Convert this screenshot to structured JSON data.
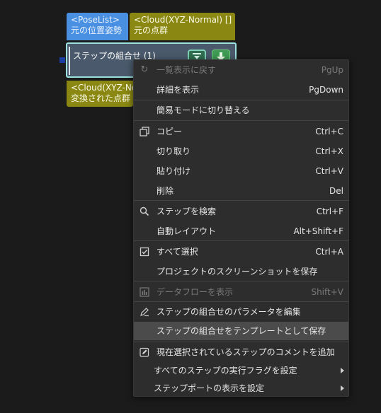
{
  "ports_top": [
    {
      "type": "<PoseList>",
      "label": "元の位置姿勢"
    },
    {
      "type": "<Cloud(XYZ-Normal) [] >",
      "label": "元の点群"
    }
  ],
  "step": {
    "title": "ステップの組合せ (1)"
  },
  "ports_bottom": [
    {
      "type": "<Cloud(XYZ-Normal)",
      "label": "変換された点群"
    }
  ],
  "menu": {
    "items": [
      {
        "icon": "undo-icon",
        "label": "一覧表示に戻す",
        "shortcut": "PgUp",
        "disabled": true
      },
      {
        "label": "詳細を表示",
        "shortcut": "PgDown"
      },
      {
        "label": "簡易モードに切り替える",
        "shortcut": ""
      },
      {
        "icon": "copy-icon",
        "label": "コピー",
        "shortcut": "Ctrl+C"
      },
      {
        "label": "切り取り",
        "shortcut": "Ctrl+X"
      },
      {
        "label": "貼り付け",
        "shortcut": "Ctrl+V"
      },
      {
        "label": "削除",
        "shortcut": "Del"
      },
      {
        "icon": "search-icon",
        "label": "ステップを検索",
        "shortcut": "Ctrl+F"
      },
      {
        "label": "自動レイアウト",
        "shortcut": "Alt+Shift+F"
      },
      {
        "icon": "select-all-icon",
        "label": "すべて選択",
        "shortcut": "Ctrl+A"
      },
      {
        "label": "プロジェクトのスクリーンショットを保存",
        "shortcut": ""
      },
      {
        "icon": "dataflow-icon",
        "label": "データフローを表示",
        "shortcut": "Shift+V",
        "disabled": true
      },
      {
        "icon": "edit-icon",
        "label": "ステップの組合せのパラメータを編集",
        "shortcut": ""
      },
      {
        "label": "ステップの組合せをテンプレートとして保存",
        "shortcut": "",
        "highlighted": true
      },
      {
        "icon": "comment-icon",
        "label": "現在選択されているステップのコメントを追加",
        "shortcut": ""
      },
      {
        "label": "すべてのステップの実行フラグを設定",
        "shortcut": "",
        "submenu": true
      },
      {
        "label": "ステップポートの表示を設定",
        "shortcut": "",
        "submenu": true
      }
    ]
  }
}
